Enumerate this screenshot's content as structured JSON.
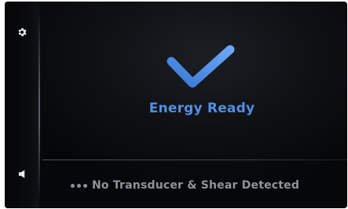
{
  "status": {
    "title": "Energy Ready",
    "icon": "checkmark-icon",
    "accent_color": "#4f8fe6"
  },
  "sidebar": {
    "top_icon": "gear-icon",
    "bottom_icon": "speaker-icon"
  },
  "message": {
    "text": "No Transducer & Shear Detected",
    "indicator_icon": "three-dots-icon",
    "text_color": "#8f949a"
  }
}
